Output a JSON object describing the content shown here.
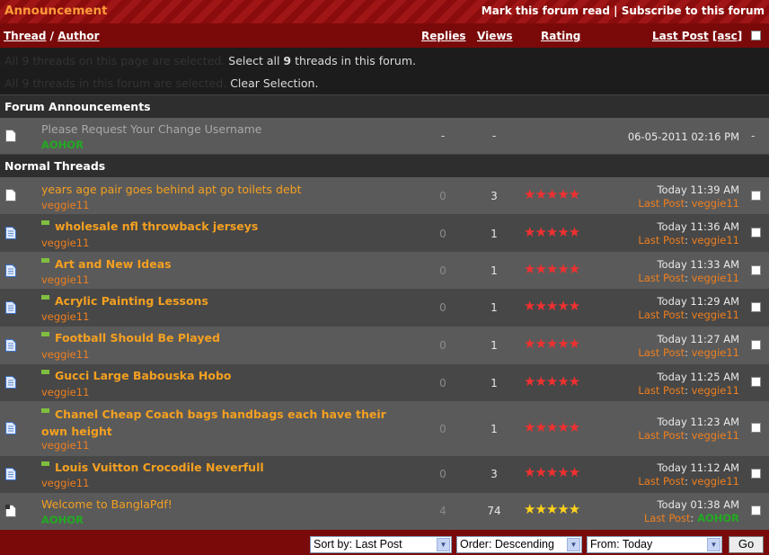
{
  "topbar": {
    "title": "Announcement",
    "mark_read": "Mark this forum read",
    "separator": "|",
    "subscribe": "Subscribe to this forum"
  },
  "header": {
    "thread": "Thread",
    "slash": "/",
    "author": "Author",
    "replies": "Replies",
    "views": "Views",
    "rating": "Rating",
    "last_post": "Last Post",
    "asc": "[asc]"
  },
  "selection": {
    "line1_dim": "All 9 threads on this page are selected.",
    "line1_link_prefix": "Select all ",
    "line1_link_count": "9",
    "line1_link_suffix": " threads in this forum.",
    "line2_dim": "All 9 threads in this forum are selected.",
    "line2_link": "Clear Selection."
  },
  "sections": {
    "announcements": "Forum Announcements",
    "normal": "Normal Threads"
  },
  "announcement": {
    "title": "Please Request Your Change Username",
    "author": "AOHOR",
    "replies": "-",
    "views": "-",
    "date": "06-05-2011 02:16 PM",
    "mod": "-"
  },
  "threads": [
    {
      "title": "years age pair goes behind apt go toilets debt",
      "author": "veggie11",
      "replies": "0",
      "views": "3",
      "time": "Today 11:39 AM",
      "last_label": "Last Post",
      "last_user": "veggie11"
    },
    {
      "title": "wholesale nfl throwback jerseys",
      "author": "veggie11",
      "replies": "0",
      "views": "1",
      "time": "Today 11:36 AM",
      "last_label": "Last Post",
      "last_user": "veggie11"
    },
    {
      "title": "Art and New Ideas",
      "author": "veggie11",
      "replies": "0",
      "views": "1",
      "time": "Today 11:33 AM",
      "last_label": "Last Post",
      "last_user": "veggie11"
    },
    {
      "title": "Acrylic Painting Lessons",
      "author": "veggie11",
      "replies": "0",
      "views": "1",
      "time": "Today 11:29 AM",
      "last_label": "Last Post",
      "last_user": "veggie11"
    },
    {
      "title": "Football Should Be Played",
      "author": "veggie11",
      "replies": "0",
      "views": "1",
      "time": "Today 11:27 AM",
      "last_label": "Last Post",
      "last_user": "veggie11"
    },
    {
      "title": "Gucci Large Babouska Hobo",
      "author": "veggie11",
      "replies": "0",
      "views": "1",
      "time": "Today 11:25 AM",
      "last_label": "Last Post",
      "last_user": "veggie11"
    },
    {
      "title_line1": "Chanel Cheap Coach bags handbags each have their",
      "title_line2": "own height",
      "author": "veggie11",
      "replies": "0",
      "views": "1",
      "time": "Today 11:23 AM",
      "last_label": "Last Post",
      "last_user": "veggie11"
    },
    {
      "title": "Louis Vuitton Crocodile Neverfull",
      "author": "veggie11",
      "replies": "0",
      "views": "3",
      "time": "Today 11:12 AM",
      "last_label": "Last Post",
      "last_user": "veggie11"
    },
    {
      "title": "Welcome to BanglaPdf!",
      "author": "AOHOR",
      "replies": "4",
      "views": "74",
      "time": "Today 01:38 AM",
      "last_label": "Last Post",
      "last_user": "AOHOR"
    }
  ],
  "stars": "★★★★★",
  "colon": ":",
  "footer": {
    "sort": "Sort by: Last Post",
    "order": "Order: Descending",
    "from": "From: Today",
    "go": "Go"
  },
  "colors": {
    "accent": "#f4a020",
    "bar": "#7a0a0a",
    "stars_red": "#f03030",
    "stars_gold": "#ffd21a",
    "green_user": "#22aa22"
  }
}
